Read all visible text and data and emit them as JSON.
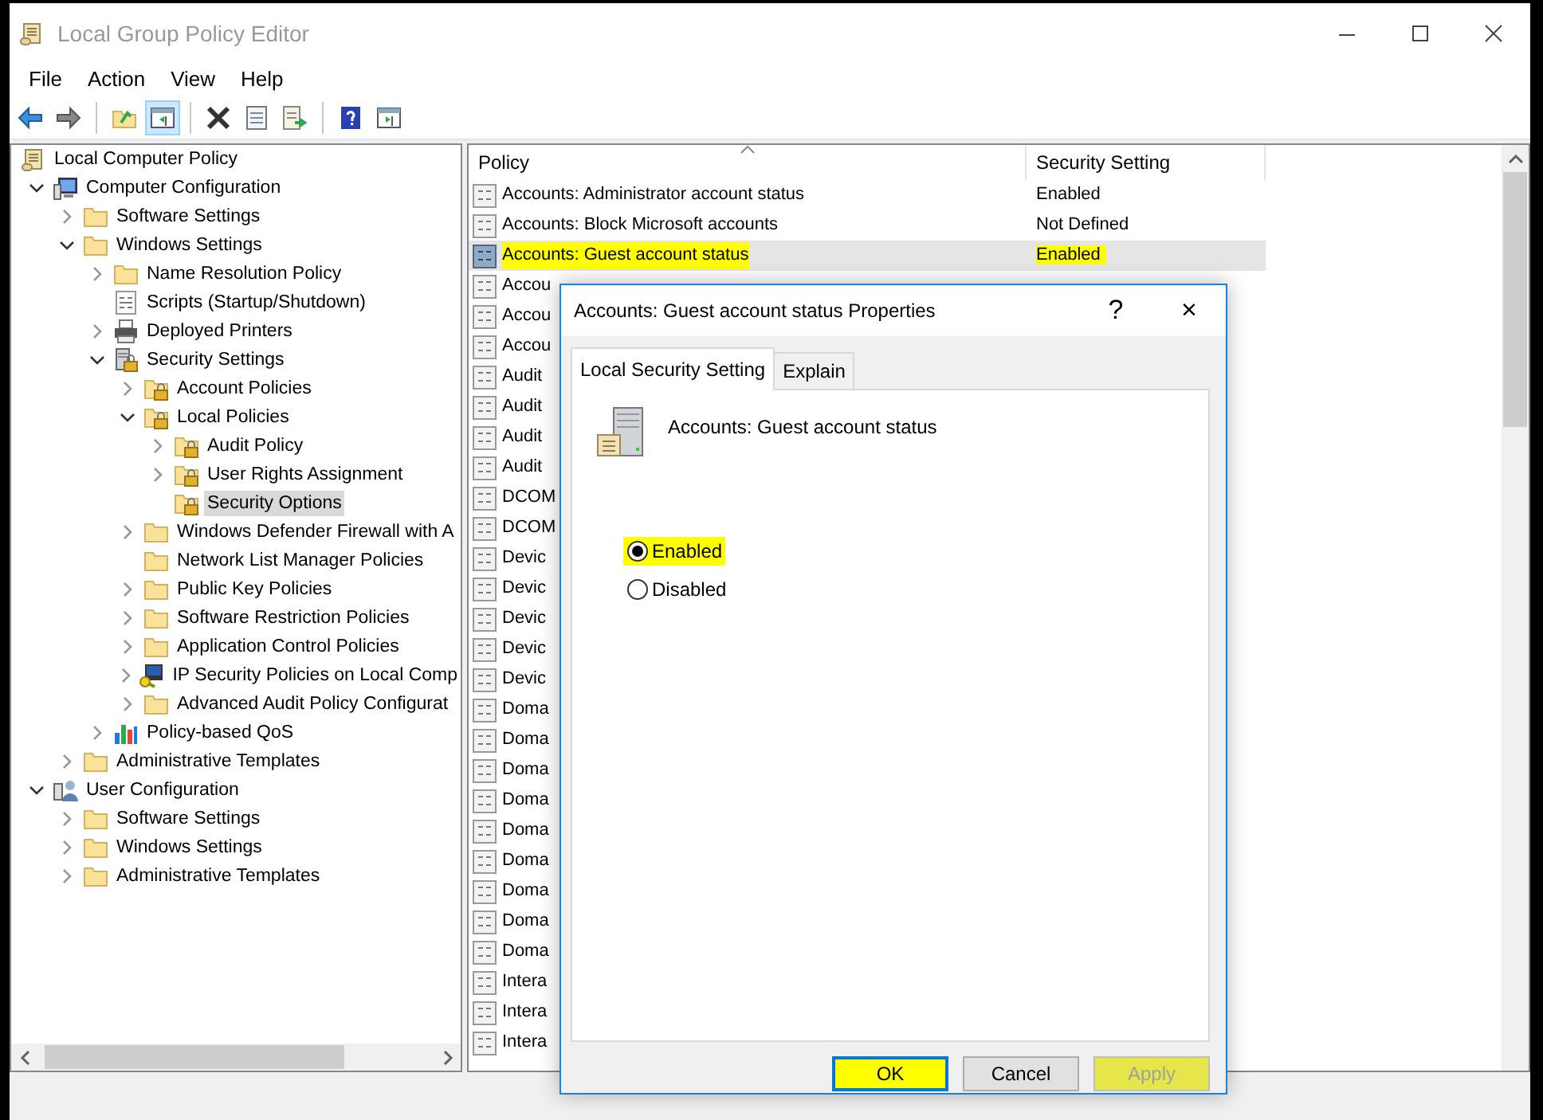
{
  "window": {
    "title": "Local Group Policy Editor"
  },
  "menu": [
    "File",
    "Action",
    "View",
    "Help"
  ],
  "toolbar": [
    {
      "kind": "back",
      "pressed": false
    },
    {
      "kind": "forward",
      "pressed": false
    },
    {
      "kind": "sep"
    },
    {
      "kind": "up",
      "pressed": false
    },
    {
      "kind": "tree",
      "pressed": true
    },
    {
      "kind": "sep"
    },
    {
      "kind": "delete",
      "pressed": false
    },
    {
      "kind": "properties",
      "pressed": false
    },
    {
      "kind": "export",
      "pressed": false
    },
    {
      "kind": "sep"
    },
    {
      "kind": "help",
      "pressed": false
    },
    {
      "kind": "pane",
      "pressed": false
    }
  ],
  "tree": [
    {
      "label": "Local Computer Policy",
      "kind": "scroll",
      "selected": false,
      "children": [
        {
          "label": "Computer Configuration",
          "kind": "computer",
          "expanded": true,
          "selected": false,
          "children": [
            {
              "label": "Software Settings",
              "kind": "folder",
              "expanded": false,
              "selected": false
            },
            {
              "label": "Windows Settings",
              "kind": "folder",
              "expanded": true,
              "selected": false,
              "children": [
                {
                  "label": "Name Resolution Policy",
                  "kind": "folder",
                  "expanded": false,
                  "selected": false
                },
                {
                  "label": "Scripts (Startup/Shutdown)",
                  "kind": "script",
                  "selected": false
                },
                {
                  "label": "Deployed Printers",
                  "kind": "printer",
                  "expanded": false,
                  "selected": false
                },
                {
                  "label": "Security Settings",
                  "kind": "security",
                  "expanded": true,
                  "selected": false,
                  "children": [
                    {
                      "label": "Account Policies",
                      "kind": "lockfolder",
                      "expanded": false,
                      "selected": false
                    },
                    {
                      "label": "Local Policies",
                      "kind": "lockfolder",
                      "expanded": true,
                      "selected": false,
                      "children": [
                        {
                          "label": "Audit Policy",
                          "kind": "lockfolder",
                          "expanded": false,
                          "selected": false
                        },
                        {
                          "label": "User Rights Assignment",
                          "kind": "lockfolder",
                          "expanded": false,
                          "selected": false
                        },
                        {
                          "label": "Security Options",
                          "kind": "lockfolder",
                          "selected": true
                        }
                      ]
                    },
                    {
                      "label": "Windows Defender Firewall with A",
                      "kind": "folder",
                      "expanded": false,
                      "selected": false
                    },
                    {
                      "label": "Network List Manager Policies",
                      "kind": "folder",
                      "selected": false
                    },
                    {
                      "label": "Public Key Policies",
                      "kind": "folder",
                      "expanded": false,
                      "selected": false
                    },
                    {
                      "label": "Software Restriction Policies",
                      "kind": "folder",
                      "expanded": false,
                      "selected": false
                    },
                    {
                      "label": "Application Control Policies",
                      "kind": "folder",
                      "expanded": false,
                      "selected": false
                    },
                    {
                      "label": "IP Security Policies on Local Comp",
                      "kind": "ipsec",
                      "expanded": false,
                      "selected": false
                    },
                    {
                      "label": "Advanced Audit Policy Configurat",
                      "kind": "folder",
                      "expanded": false,
                      "selected": false
                    }
                  ]
                },
                {
                  "label": "Policy-based QoS",
                  "kind": "qos",
                  "expanded": false,
                  "selected": false
                }
              ]
            },
            {
              "label": "Administrative Templates",
              "kind": "folder",
              "expanded": false,
              "selected": false
            }
          ]
        },
        {
          "label": "User Configuration",
          "kind": "user",
          "expanded": true,
          "selected": false,
          "children": [
            {
              "label": "Software Settings",
              "kind": "folder",
              "expanded": false,
              "selected": false
            },
            {
              "label": "Windows Settings",
              "kind": "folder",
              "expanded": false,
              "selected": false
            },
            {
              "label": "Administrative Templates",
              "kind": "folder",
              "expanded": false,
              "selected": false
            }
          ]
        }
      ]
    }
  ],
  "table": {
    "columns": [
      "Policy",
      "Security Setting"
    ],
    "rows": [
      {
        "policy": "Accounts: Administrator account status",
        "setting": "Enabled",
        "selected": false,
        "highlighted": false
      },
      {
        "policy": "Accounts: Block Microsoft accounts",
        "setting": "Not Defined",
        "selected": false,
        "highlighted": false
      },
      {
        "policy": "Accounts: Guest account status",
        "setting": "Enabled",
        "selected": true,
        "highlighted": true
      },
      {
        "policy": "Accou",
        "selected": false,
        "highlighted": false
      },
      {
        "policy": "Accou",
        "selected": false,
        "highlighted": false
      },
      {
        "policy": "Accou",
        "selected": false,
        "highlighted": false
      },
      {
        "policy": "Audit",
        "selected": false,
        "highlighted": false
      },
      {
        "policy": "Audit",
        "selected": false,
        "highlighted": false
      },
      {
        "policy": "Audit",
        "selected": false,
        "highlighted": false
      },
      {
        "policy": "Audit",
        "selected": false,
        "highlighted": false
      },
      {
        "policy": "DCOM",
        "selected": false,
        "highlighted": false
      },
      {
        "policy": "DCOM",
        "selected": false,
        "highlighted": false
      },
      {
        "policy": "Devic",
        "selected": false,
        "highlighted": false
      },
      {
        "policy": "Devic",
        "selected": false,
        "highlighted": false
      },
      {
        "policy": "Devic",
        "selected": false,
        "highlighted": false
      },
      {
        "policy": "Devic",
        "selected": false,
        "highlighted": false
      },
      {
        "policy": "Devic",
        "selected": false,
        "highlighted": false
      },
      {
        "policy": "Doma",
        "selected": false,
        "highlighted": false
      },
      {
        "policy": "Doma",
        "selected": false,
        "highlighted": false
      },
      {
        "policy": "Doma",
        "selected": false,
        "highlighted": false
      },
      {
        "policy": "Doma",
        "selected": false,
        "highlighted": false
      },
      {
        "policy": "Doma",
        "selected": false,
        "highlighted": false
      },
      {
        "policy": "Doma",
        "selected": false,
        "highlighted": false
      },
      {
        "policy": "Doma",
        "selected": false,
        "highlighted": false
      },
      {
        "policy": "Doma",
        "selected": false,
        "highlighted": false
      },
      {
        "policy": "Doma",
        "selected": false,
        "highlighted": false
      },
      {
        "policy": "Intera",
        "selected": false,
        "highlighted": false
      },
      {
        "policy": "Intera",
        "selected": false,
        "highlighted": false
      },
      {
        "policy": "Intera",
        "selected": false,
        "highlighted": false
      }
    ]
  },
  "dialog": {
    "title": "Accounts: Guest account status Properties",
    "help": "?",
    "close": "×",
    "tabs": [
      {
        "label": "Local Security Setting",
        "selected": true
      },
      {
        "label": "Explain",
        "selected": false
      }
    ],
    "heading": "Accounts: Guest account status",
    "options": [
      {
        "label": "Enabled",
        "selected": true,
        "highlighted": true
      },
      {
        "label": "Disabled",
        "selected": false,
        "highlighted": false
      }
    ],
    "buttons": [
      {
        "label": "OK",
        "disabled": false,
        "default": true,
        "highlighted": true
      },
      {
        "label": "Cancel",
        "disabled": false,
        "default": false,
        "highlighted": false
      },
      {
        "label": "Apply",
        "disabled": true,
        "default": false,
        "highlighted": true
      }
    ]
  }
}
